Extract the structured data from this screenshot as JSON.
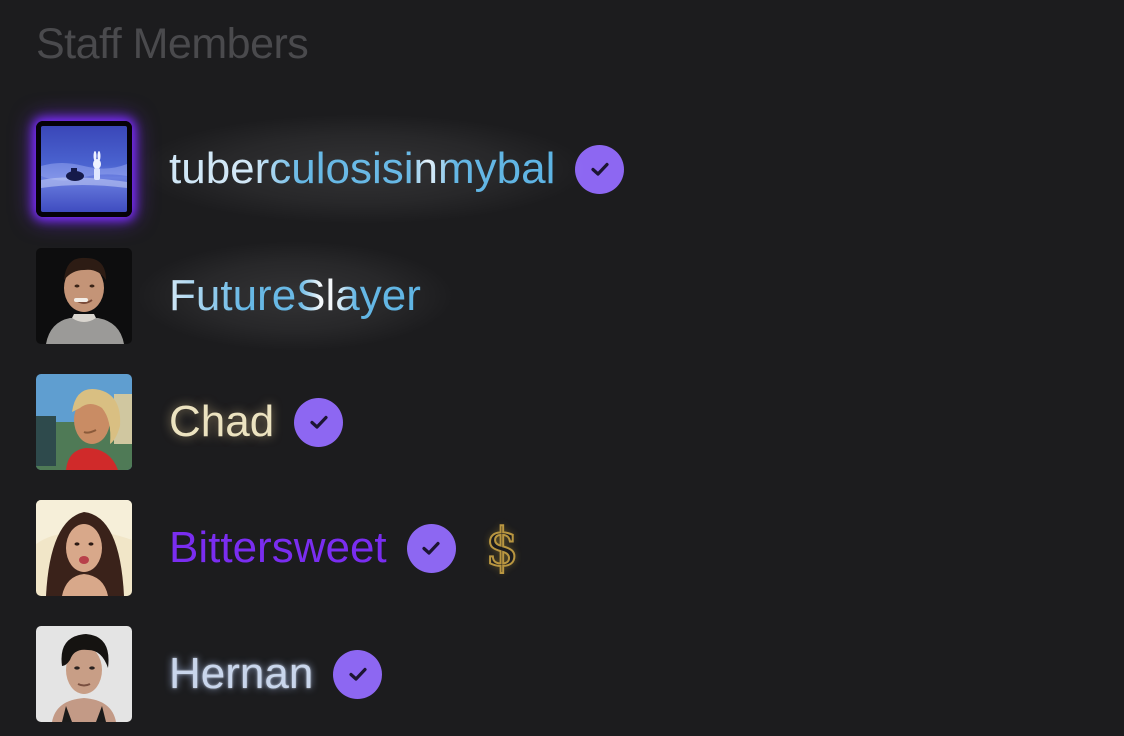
{
  "section": {
    "title": "Staff Members"
  },
  "members": [
    {
      "name": "tuberculosisinmybal",
      "verified": true,
      "icon": "verified-badge-icon"
    },
    {
      "name": "FutureSlayer",
      "verified": false
    },
    {
      "name": "Chad",
      "verified": true,
      "icon": "verified-badge-icon"
    },
    {
      "name": "Bittersweet",
      "verified": true,
      "icon": "verified-badge-icon",
      "extra_icon": "dollar-sign-icon",
      "extra_symbol": "$"
    },
    {
      "name": "Hernan",
      "verified": true,
      "icon": "verified-badge-icon"
    }
  ],
  "colors": {
    "background": "#1c1c1e",
    "section_title": "#4a4a4d",
    "verified_badge": "#8d67f2",
    "avatar_frame_glow": "#7b2cff",
    "name_blue": "#5ab2e3",
    "name_cream": "#ece3c0",
    "name_purple": "#7a2df0",
    "name_silver": "#c9d6ec",
    "dollar_gold": "#b99640"
  }
}
